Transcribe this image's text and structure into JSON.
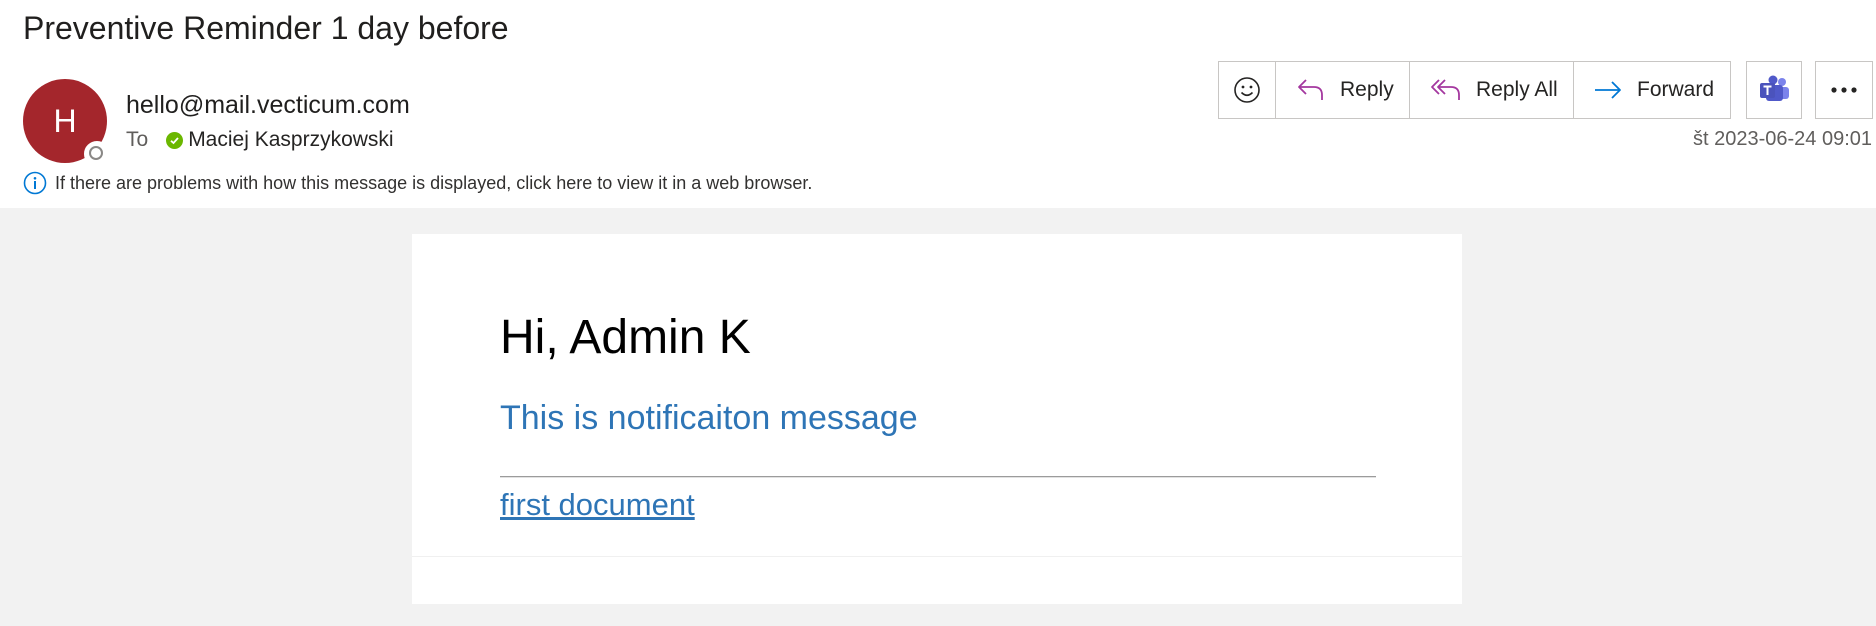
{
  "email": {
    "subject": "Preventive Reminder 1 day before",
    "avatar_initial": "H",
    "avatar_color": "#a4262c",
    "sender": "hello@mail.vecticum.com",
    "to_label": "To",
    "recipient": "Maciej Kasprzykowski",
    "recipient_status": "available",
    "info_message": "If there are problems with how this message is displayed, click here to view it in a web browser.",
    "date": "št 2023-06-24 09:01"
  },
  "toolbar": {
    "emoji_icon": "smiley-icon",
    "reply_label": "Reply",
    "reply_all_label": "Reply All",
    "forward_label": "Forward",
    "teams_icon": "teams-icon",
    "more_icon": "more-icon"
  },
  "content": {
    "greeting": "Hi, Admin K",
    "message": "This is notificaiton message",
    "link_text": "first document",
    "accent_color": "#2e75b6"
  }
}
